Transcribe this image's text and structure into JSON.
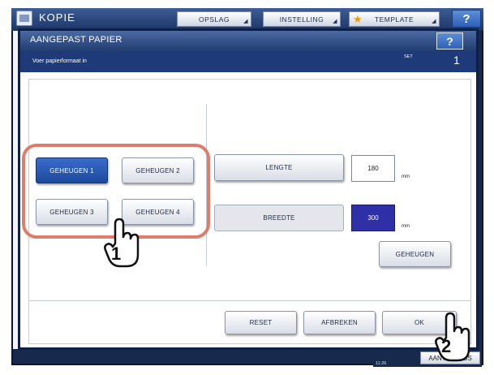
{
  "app": {
    "title": "KOPIE",
    "menu": {
      "opslag": "OPSLAG",
      "instelling": "INSTELLING",
      "template": "TEMPLATE"
    },
    "help_label": "?",
    "status_button": "AANTAL JOBS",
    "clock": "11:26"
  },
  "dialog": {
    "title": "AANGEPAST PAPIER",
    "help_label": "?",
    "message": "Voer papierformaat in",
    "set_label": "SET",
    "set_value": "1",
    "memory": {
      "m1": "GEHEUGEN 1",
      "m2": "GEHEUGEN 2",
      "m3": "GEHEUGEN 3",
      "m4": "GEHEUGEN 4",
      "selected": "GEHEUGEN 1"
    },
    "length": {
      "label": "LENGTE",
      "value": "180",
      "unit": "mm"
    },
    "width": {
      "label": "BREEDTE",
      "value": "300",
      "unit": "mm"
    },
    "store_button": "GEHEUGEN",
    "footer": {
      "reset": "RESET",
      "cancel": "AFBREKEN",
      "ok": "OK"
    }
  },
  "callouts": {
    "step1": "1",
    "step2": "2"
  },
  "colors": {
    "highlight_outline": "#e07c6a",
    "selected_button": "#1c4a9c",
    "selected_field": "#2f2fa8"
  }
}
